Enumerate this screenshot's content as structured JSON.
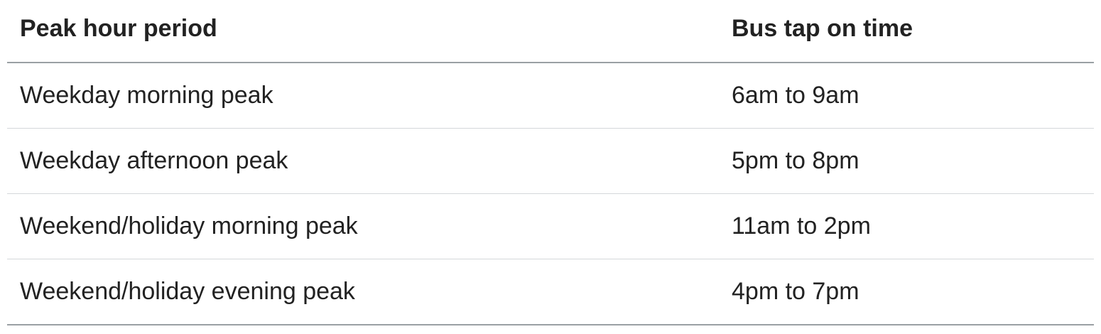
{
  "table": {
    "headers": [
      "Peak hour period",
      "Bus tap on time"
    ],
    "rows": [
      [
        "Weekday morning peak",
        "6am to 9am"
      ],
      [
        "Weekday afternoon peak",
        "5pm to 8pm"
      ],
      [
        "Weekend/holiday morning peak",
        "11am to 2pm"
      ],
      [
        "Weekend/holiday evening peak",
        "4pm to 7pm"
      ]
    ]
  },
  "colors": {
    "text": "#222222",
    "header_rule": "#9aa0a4",
    "row_rule": "#d4d7da",
    "background": "#ffffff"
  }
}
